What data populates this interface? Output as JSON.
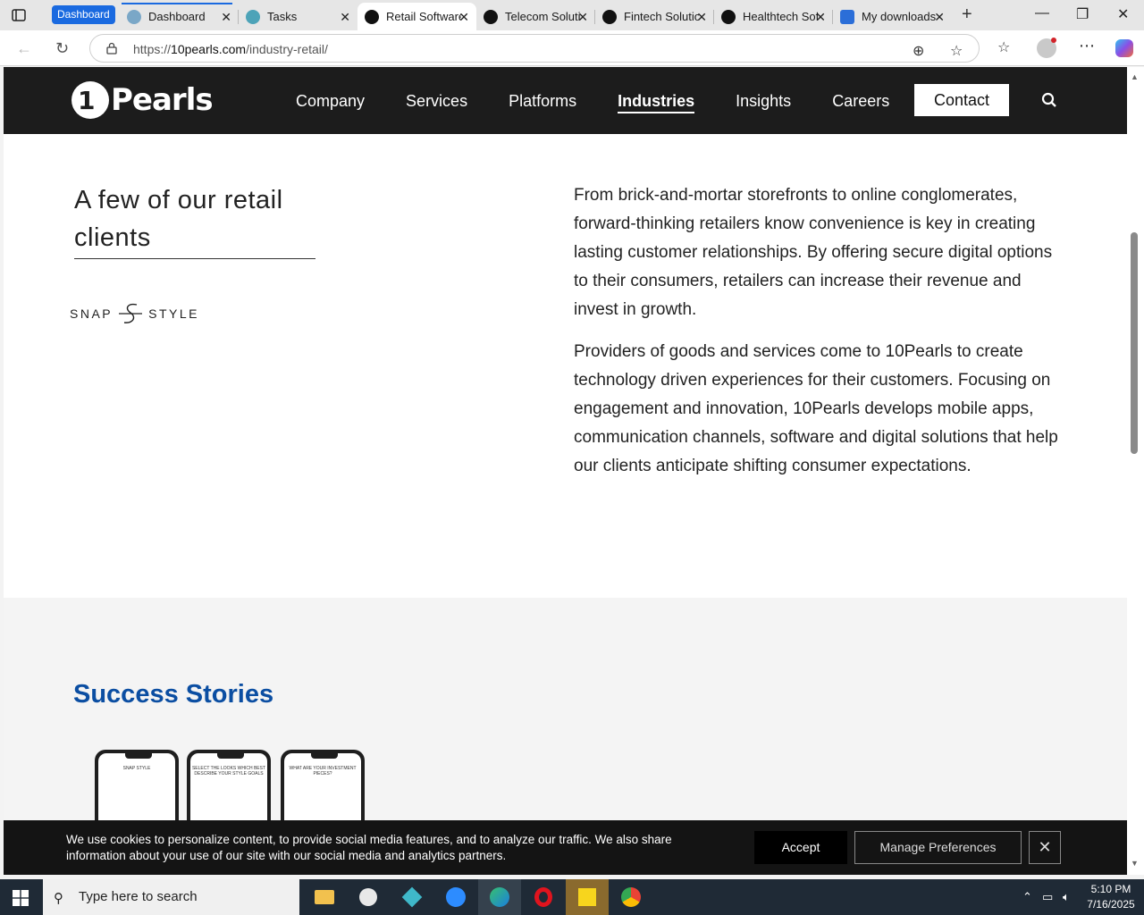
{
  "browser": {
    "group_badge": "Dashboard",
    "tabs": [
      {
        "label": "Dashboard",
        "color": "#7aa7c7"
      },
      {
        "label": "Tasks",
        "color": "#4da3b8"
      },
      {
        "label": "Retail Software",
        "color": "#111111"
      },
      {
        "label": "Telecom Solutions",
        "color": "#111111"
      },
      {
        "label": "Fintech Solutions",
        "color": "#111111"
      },
      {
        "label": "Healthtech Software",
        "color": "#111111"
      },
      {
        "label": "My downloads",
        "color": "#2b6ed8"
      }
    ],
    "url_prefix": "https://",
    "url_host": "10pearls.com",
    "url_path": "/industry-retail/"
  },
  "site": {
    "logo_mark": "1",
    "logo_text": "Pearls",
    "nav": [
      "Company",
      "Services",
      "Platforms",
      "Industries",
      "Insights",
      "Careers"
    ],
    "contact": "Contact"
  },
  "clients": {
    "title": "A few of our retail clients",
    "logo_left": "SNAP",
    "logo_right": "STYLE"
  },
  "intro": {
    "p1": "From brick-and-mortar storefronts to online conglomerates, forward-thinking retailers know convenience is key in creating lasting customer relationships. By offering secure digital options to their consumers, retailers can increase their revenue and invest in growth.",
    "p2": "Providers of goods and services come to 10Pearls to create technology driven experiences for their customers. Focusing on engagement and innovation, 10Pearls develops mobile apps, communication channels, software and digital solutions that help our clients anticipate shifting consumer expectations."
  },
  "stories": {
    "title": "Success Stories",
    "phones": [
      "SNAP STYLE",
      "SELECT THE LOOKS WHICH BEST DESCRIBE YOUR STYLE GOALS",
      "WHAT ARE YOUR INVESTMENT PIECES?"
    ]
  },
  "cookie": {
    "text": "We use cookies to personalize content, to provide social media features, and to analyze our traffic. We also share information about your use of our site with our social media and analytics partners.",
    "accept": "Accept",
    "manage": "Manage Preferences"
  },
  "taskbar": {
    "search_placeholder": "Type here to search",
    "time": "5:10 PM",
    "date": "7/16/2025"
  },
  "colors": {
    "accent": "#0b4ea2",
    "header_bg": "#1c1c1c",
    "edge_blue": "#1a6ae0"
  }
}
